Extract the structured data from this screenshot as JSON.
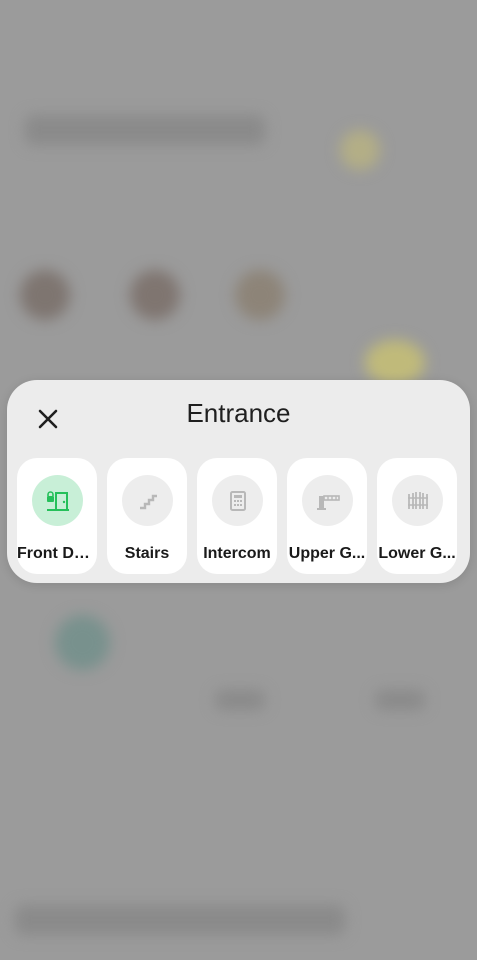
{
  "dialog": {
    "title": "Entrance",
    "close_icon": "close-icon"
  },
  "colors": {
    "active": "#25c05a",
    "active_bg": "#c8efd7",
    "inactive_icon": "#b8b8b8",
    "tile_bg": "#ffffff",
    "dialog_bg": "#ececec"
  },
  "tiles": [
    {
      "label": "Front Door",
      "icon": "door-lock-icon",
      "active": true
    },
    {
      "label": "Stairs",
      "icon": "stairs-icon",
      "active": false
    },
    {
      "label": "Intercom",
      "icon": "intercom-icon",
      "active": false
    },
    {
      "label": "Upper G...",
      "icon": "gate-barrier-icon",
      "active": false
    },
    {
      "label": "Lower G...",
      "icon": "fence-gate-icon",
      "active": false
    }
  ]
}
